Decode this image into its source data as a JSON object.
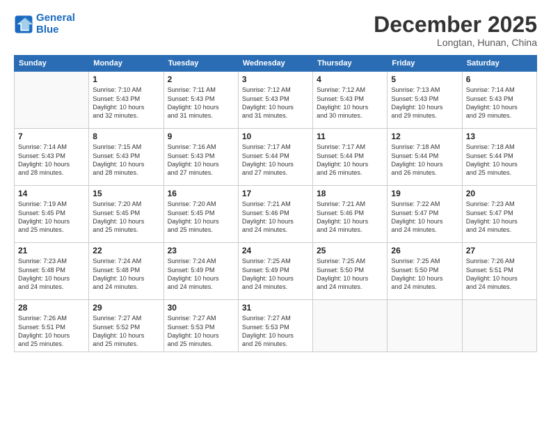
{
  "logo": {
    "line1": "General",
    "line2": "Blue"
  },
  "title": "December 2025",
  "location": "Longtan, Hunan, China",
  "headers": [
    "Sunday",
    "Monday",
    "Tuesday",
    "Wednesday",
    "Thursday",
    "Friday",
    "Saturday"
  ],
  "weeks": [
    [
      {
        "day": "",
        "info": ""
      },
      {
        "day": "1",
        "info": "Sunrise: 7:10 AM\nSunset: 5:43 PM\nDaylight: 10 hours\nand 32 minutes."
      },
      {
        "day": "2",
        "info": "Sunrise: 7:11 AM\nSunset: 5:43 PM\nDaylight: 10 hours\nand 31 minutes."
      },
      {
        "day": "3",
        "info": "Sunrise: 7:12 AM\nSunset: 5:43 PM\nDaylight: 10 hours\nand 31 minutes."
      },
      {
        "day": "4",
        "info": "Sunrise: 7:12 AM\nSunset: 5:43 PM\nDaylight: 10 hours\nand 30 minutes."
      },
      {
        "day": "5",
        "info": "Sunrise: 7:13 AM\nSunset: 5:43 PM\nDaylight: 10 hours\nand 29 minutes."
      },
      {
        "day": "6",
        "info": "Sunrise: 7:14 AM\nSunset: 5:43 PM\nDaylight: 10 hours\nand 29 minutes."
      }
    ],
    [
      {
        "day": "7",
        "info": "Sunrise: 7:14 AM\nSunset: 5:43 PM\nDaylight: 10 hours\nand 28 minutes."
      },
      {
        "day": "8",
        "info": "Sunrise: 7:15 AM\nSunset: 5:43 PM\nDaylight: 10 hours\nand 28 minutes."
      },
      {
        "day": "9",
        "info": "Sunrise: 7:16 AM\nSunset: 5:43 PM\nDaylight: 10 hours\nand 27 minutes."
      },
      {
        "day": "10",
        "info": "Sunrise: 7:17 AM\nSunset: 5:44 PM\nDaylight: 10 hours\nand 27 minutes."
      },
      {
        "day": "11",
        "info": "Sunrise: 7:17 AM\nSunset: 5:44 PM\nDaylight: 10 hours\nand 26 minutes."
      },
      {
        "day": "12",
        "info": "Sunrise: 7:18 AM\nSunset: 5:44 PM\nDaylight: 10 hours\nand 26 minutes."
      },
      {
        "day": "13",
        "info": "Sunrise: 7:18 AM\nSunset: 5:44 PM\nDaylight: 10 hours\nand 25 minutes."
      }
    ],
    [
      {
        "day": "14",
        "info": "Sunrise: 7:19 AM\nSunset: 5:45 PM\nDaylight: 10 hours\nand 25 minutes."
      },
      {
        "day": "15",
        "info": "Sunrise: 7:20 AM\nSunset: 5:45 PM\nDaylight: 10 hours\nand 25 minutes."
      },
      {
        "day": "16",
        "info": "Sunrise: 7:20 AM\nSunset: 5:45 PM\nDaylight: 10 hours\nand 25 minutes."
      },
      {
        "day": "17",
        "info": "Sunrise: 7:21 AM\nSunset: 5:46 PM\nDaylight: 10 hours\nand 24 minutes."
      },
      {
        "day": "18",
        "info": "Sunrise: 7:21 AM\nSunset: 5:46 PM\nDaylight: 10 hours\nand 24 minutes."
      },
      {
        "day": "19",
        "info": "Sunrise: 7:22 AM\nSunset: 5:47 PM\nDaylight: 10 hours\nand 24 minutes."
      },
      {
        "day": "20",
        "info": "Sunrise: 7:23 AM\nSunset: 5:47 PM\nDaylight: 10 hours\nand 24 minutes."
      }
    ],
    [
      {
        "day": "21",
        "info": "Sunrise: 7:23 AM\nSunset: 5:48 PM\nDaylight: 10 hours\nand 24 minutes."
      },
      {
        "day": "22",
        "info": "Sunrise: 7:24 AM\nSunset: 5:48 PM\nDaylight: 10 hours\nand 24 minutes."
      },
      {
        "day": "23",
        "info": "Sunrise: 7:24 AM\nSunset: 5:49 PM\nDaylight: 10 hours\nand 24 minutes."
      },
      {
        "day": "24",
        "info": "Sunrise: 7:25 AM\nSunset: 5:49 PM\nDaylight: 10 hours\nand 24 minutes."
      },
      {
        "day": "25",
        "info": "Sunrise: 7:25 AM\nSunset: 5:50 PM\nDaylight: 10 hours\nand 24 minutes."
      },
      {
        "day": "26",
        "info": "Sunrise: 7:25 AM\nSunset: 5:50 PM\nDaylight: 10 hours\nand 24 minutes."
      },
      {
        "day": "27",
        "info": "Sunrise: 7:26 AM\nSunset: 5:51 PM\nDaylight: 10 hours\nand 24 minutes."
      }
    ],
    [
      {
        "day": "28",
        "info": "Sunrise: 7:26 AM\nSunset: 5:51 PM\nDaylight: 10 hours\nand 25 minutes."
      },
      {
        "day": "29",
        "info": "Sunrise: 7:27 AM\nSunset: 5:52 PM\nDaylight: 10 hours\nand 25 minutes."
      },
      {
        "day": "30",
        "info": "Sunrise: 7:27 AM\nSunset: 5:53 PM\nDaylight: 10 hours\nand 25 minutes."
      },
      {
        "day": "31",
        "info": "Sunrise: 7:27 AM\nSunset: 5:53 PM\nDaylight: 10 hours\nand 26 minutes."
      },
      {
        "day": "",
        "info": ""
      },
      {
        "day": "",
        "info": ""
      },
      {
        "day": "",
        "info": ""
      }
    ]
  ]
}
